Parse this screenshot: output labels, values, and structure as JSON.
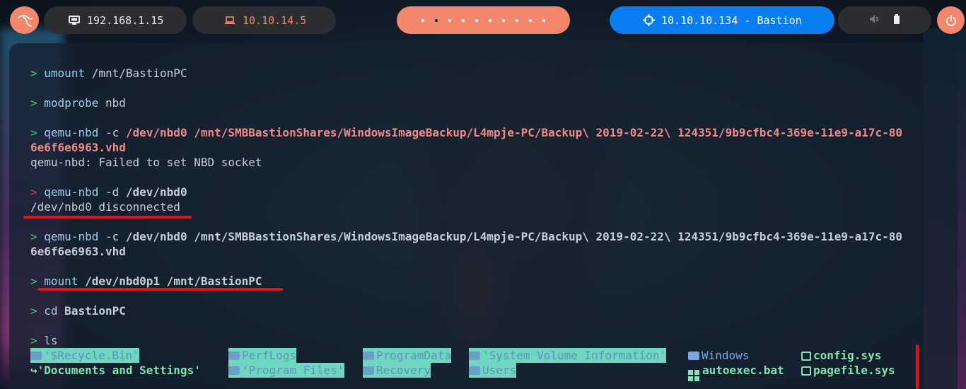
{
  "topbar": {
    "local_ip": "192.168.1.15",
    "vpn_ip": "10.10.14.5",
    "workspace_count": 10,
    "active_workspace_index": 1,
    "target": "10.10.10.134 - Bastion"
  },
  "terminal": {
    "prompt": ">",
    "lines": {
      "l1_cmd": "umount",
      "l1_args": " /mnt/BastionPC",
      "l2_cmd": "modprobe",
      "l2_args": " nbd",
      "l3_cmd": "qemu-nbd",
      "l3_flag": " -c ",
      "l3_args_a": "/dev/nbd0 /mnt/SMBBastionShares/WindowsImageBackup/L4mpje-PC/Backup\\ 2019-02-22\\ 124351/9b9cfbc4-369e-11e9-a17c-80",
      "l3_args_b": "6e6f6e6963.vhd",
      "l3_output": "qemu-nbd: Failed to set NBD socket",
      "l4_cmd": "qemu-nbd",
      "l4_flag": " -d ",
      "l4_args": "/dev/nbd0",
      "l4_output": "/dev/nbd0 disconnected",
      "l5_cmd": "qemu-nbd",
      "l5_flag": " -c ",
      "l5_args_a": "/dev/nbd0 /mnt/SMBBastionShares/WindowsImageBackup/L4mpje-PC/Backup\\ 2019-02-22\\ 124351/9b9cfbc4-369e-11e9-a17c-80",
      "l5_args_b": "6e6f6e6963.vhd",
      "l6_cmd": "mount",
      "l6_args": " /dev/nbd0p1 /mnt/BastionPC",
      "l7_cmd": "cd",
      "l7_args": " BastionPC",
      "l8_cmd": "ls"
    },
    "ls_output": [
      {
        "name": "'$Recycle.Bin'",
        "kind": "dir-hl"
      },
      {
        "name": "PerfLogs",
        "kind": "dir-hl"
      },
      {
        "name": "ProgramData",
        "kind": "dir-hl"
      },
      {
        "name": "'System Volume Information'",
        "kind": "dir-hl"
      },
      {
        "name": "Windows",
        "kind": "dir-plain"
      },
      {
        "name": "config.sys",
        "kind": "file"
      },
      {
        "name": "'Documents and Settings'",
        "kind": "symlink"
      },
      {
        "name": "'Program Files'",
        "kind": "dir-hl"
      },
      {
        "name": "Recovery",
        "kind": "dir-hl"
      },
      {
        "name": "Users",
        "kind": "dir-hl"
      },
      {
        "name": "autoexec.bat",
        "kind": "file"
      },
      {
        "name": "pagefile.sys",
        "kind": "file"
      }
    ]
  },
  "colors": {
    "accent_orange": "#f3866b",
    "target_blue": "#0a7df0",
    "prompt_green": "#3ecf6e",
    "prompt_error": "#e0303a",
    "annotation_red": "#e8111b"
  },
  "icons": [
    "kali-logo-icon",
    "monitor-icon",
    "laptop-icon",
    "crosshair-icon",
    "mute-icon",
    "battery-icon",
    "power-icon"
  ]
}
